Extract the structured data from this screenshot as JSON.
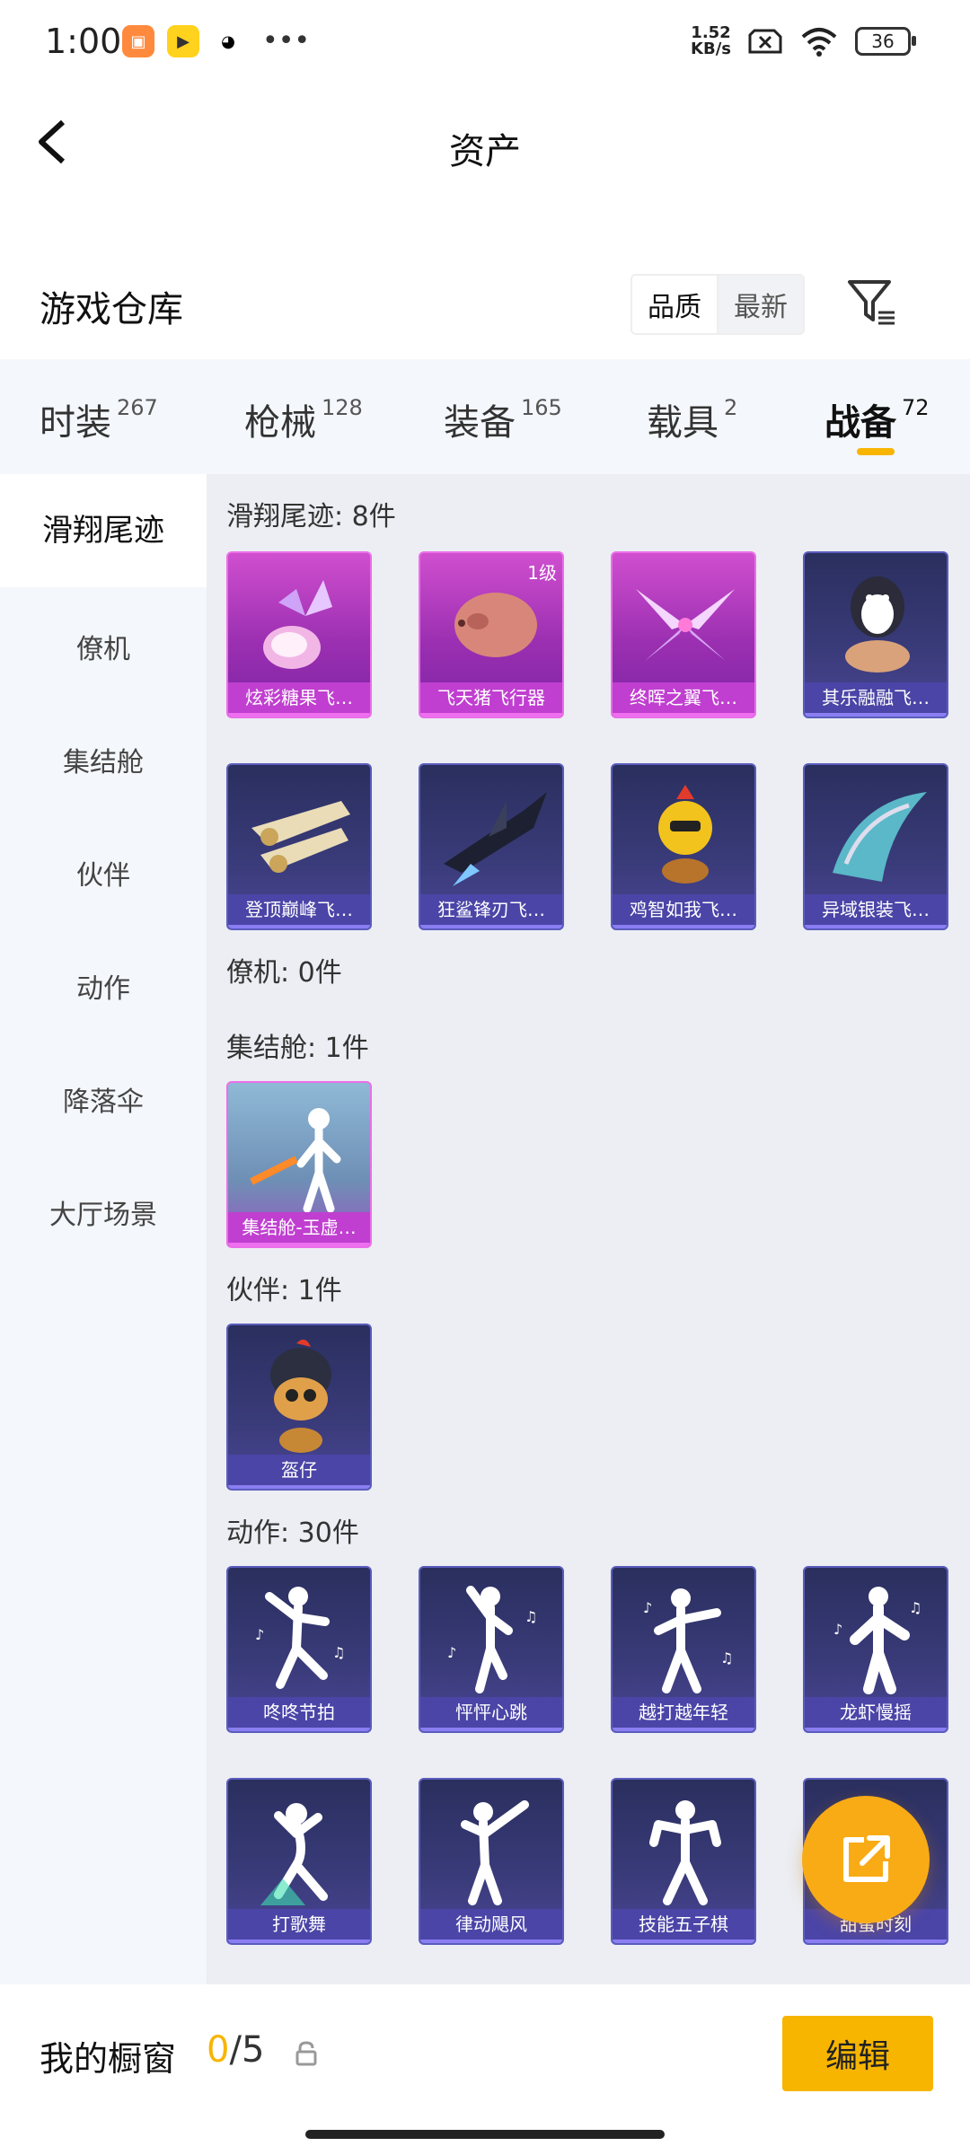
{
  "status_bar": {
    "time": "1:00",
    "net_speed_value": "1.52",
    "net_speed_unit": "KB/s",
    "battery": "36"
  },
  "header": {
    "title": "资产"
  },
  "warehouse": {
    "title": "游戏仓库",
    "sort_options": [
      "品质",
      "最新"
    ],
    "sort_selected": "品质"
  },
  "tabs": [
    {
      "label": "时装",
      "count": "267"
    },
    {
      "label": "枪械",
      "count": "128"
    },
    {
      "label": "装备",
      "count": "165"
    },
    {
      "label": "载具",
      "count": "2"
    },
    {
      "label": "战备",
      "count": "72",
      "active": true
    }
  ],
  "sidebar": {
    "items": [
      "滑翔尾迹",
      "僚机",
      "集结舱",
      "伙伴",
      "动作",
      "降落伞",
      "大厅场景"
    ],
    "selected": "滑翔尾迹"
  },
  "sections": {
    "glide": {
      "title": "滑翔尾迹: 8件",
      "items": [
        {
          "name": "炫彩糖果飞…",
          "quality": "purple"
        },
        {
          "name": "飞天猪飞行器",
          "quality": "purple",
          "level": "1级"
        },
        {
          "name": "终晖之翼飞…",
          "quality": "purple"
        },
        {
          "name": "其乐融融飞…",
          "quality": "blue"
        },
        {
          "name": "登顶巅峰飞…",
          "quality": "blue"
        },
        {
          "name": "狂鲨锋刃飞…",
          "quality": "blue"
        },
        {
          "name": "鸡智如我飞…",
          "quality": "blue"
        },
        {
          "name": "异域银装飞…",
          "quality": "blue"
        }
      ]
    },
    "wingman": {
      "title": "僚机: 0件"
    },
    "pod": {
      "title": "集结舱: 1件",
      "items": [
        {
          "name": "集结舱-玉虚…",
          "quality": "purple"
        }
      ]
    },
    "partner": {
      "title": "伙伴: 1件",
      "items": [
        {
          "name": "盔仔",
          "quality": "blue"
        }
      ]
    },
    "emote": {
      "title": "动作: 30件",
      "items": [
        {
          "name": "咚咚节拍",
          "quality": "blue"
        },
        {
          "name": "怦怦心跳",
          "quality": "blue"
        },
        {
          "name": "越打越年轻",
          "quality": "blue"
        },
        {
          "name": "龙虾慢摇",
          "quality": "blue"
        },
        {
          "name": "打歌舞",
          "quality": "blue"
        },
        {
          "name": "律动飓风",
          "quality": "blue"
        },
        {
          "name": "技能五子棋",
          "quality": "blue"
        },
        {
          "name": "甜蜜时刻",
          "quality": "blue"
        }
      ]
    }
  },
  "showcase": {
    "title": "我的橱窗",
    "current": "0",
    "separator": "/",
    "max": "5",
    "edit_label": "编辑"
  }
}
